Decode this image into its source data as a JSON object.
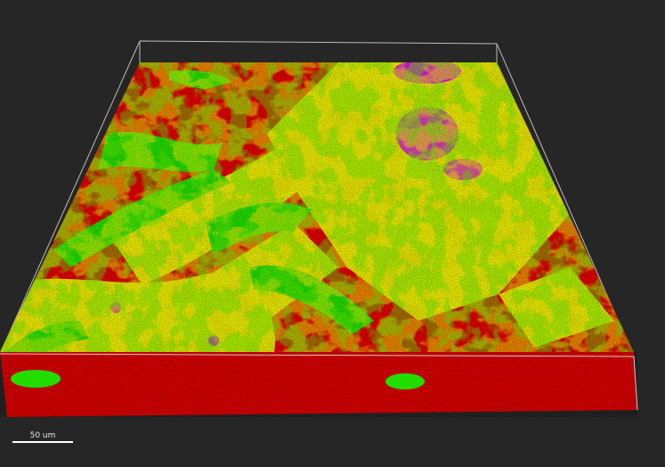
{
  "scalebar": {
    "label": "50 um"
  },
  "colors": {
    "background": "#262626",
    "channel_red": "#e00000",
    "channel_green": "#22dd00",
    "channel_yellow": "#e6e600",
    "channel_magenta": "#d81ad8",
    "bounding_box": "#bdbdbd"
  }
}
